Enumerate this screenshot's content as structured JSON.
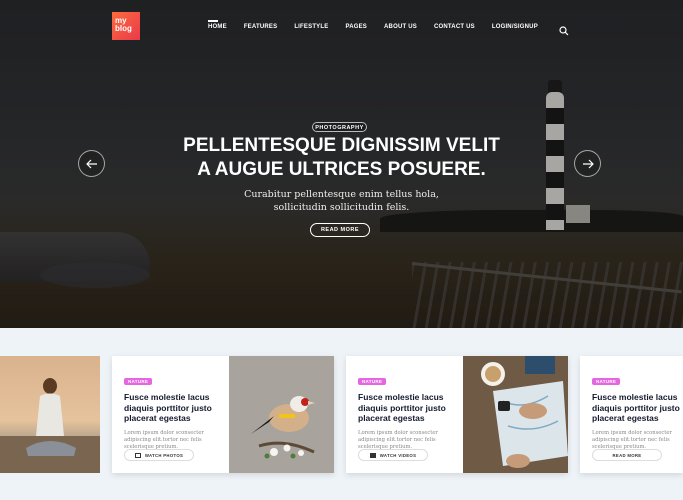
{
  "logo": {
    "line1": "my",
    "line2": "blog"
  },
  "nav": {
    "items": [
      "HOME",
      "FEATURES",
      "LIFESTYLE",
      "PAGES",
      "ABOUT US",
      "CONTACT US",
      "LOGIN/SIGNUP"
    ],
    "active": "HOME"
  },
  "icons": {
    "search": "search-icon",
    "prev": "arrow-left-icon",
    "next": "arrow-right-icon"
  },
  "hero": {
    "category": "PHOTOGRAPHY",
    "title_line1": "PELLENTESQUE DIGNISSIM VELIT",
    "title_line2": "A AUGUE ULTRICES POSUERE.",
    "subtitle_line1": "Curabitur pellentesque enim tellus hola,",
    "subtitle_line2": "sollicitudin sollicitudin felis.",
    "button": "READ MORE"
  },
  "cards": [
    {
      "tag": "NATURE",
      "title": "Fusce molestie lacus diaquis porttitor justo placerat egestas",
      "excerpt": "Lorem ipsum dolor sconsecter adipiscing elit.tortor nec felis scelerisque pretium.",
      "button": "WATCH PHOTOS",
      "image": "goldfinch-bird"
    },
    {
      "tag": "NATURE",
      "title": "Fusce molestie lacus diaquis porttitor justo placerat egestas",
      "excerpt": "Lorem ipsum dolor sconsecter adipiscing elit.tortor nec felis scelerisque pretium.",
      "button": "WATCH VIDEOS",
      "image": "travel-map"
    },
    {
      "tag": "NATURE",
      "title": "Fusce molestie lacus diaquis porttitor justo placerat egestas",
      "excerpt": "Lorem ipsum dolor sconsecter adipiscing elit.tortor nec felis scelerisque pretium.",
      "button": "READ MORE",
      "image": ""
    }
  ],
  "colors": {
    "tag": "#e466e0",
    "logo": "#f0553f",
    "title": "#141a2e"
  }
}
